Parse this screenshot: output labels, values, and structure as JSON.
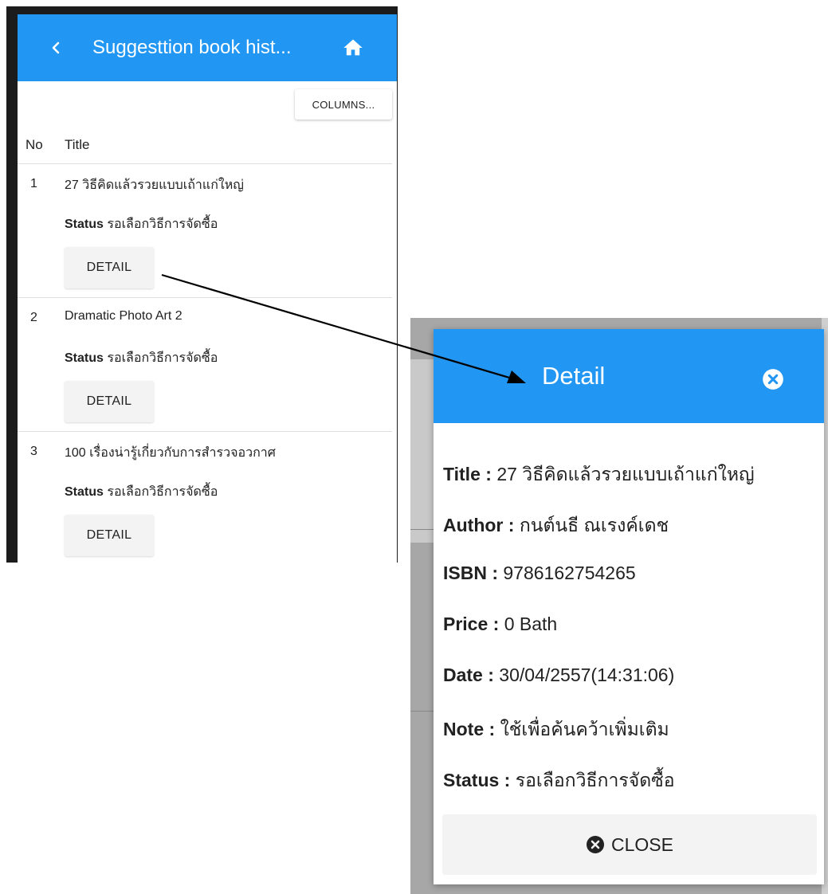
{
  "app_bar": {
    "title": "Suggesttion book hist...",
    "back_icon": "chevron-left-icon",
    "home_icon": "home-icon",
    "color": "#2196f3"
  },
  "toolbar": {
    "columns_label": "COLUMNS..."
  },
  "table": {
    "headers": {
      "no": "No",
      "title": "Title"
    },
    "status_label": "Status",
    "detail_label": "DETAIL",
    "rows": [
      {
        "no": "1",
        "title": "27 วิธีคิดแล้วรวยแบบเถ้าแก่ใหญ่",
        "status": "รอเลือกวิธีการจัดซื้อ"
      },
      {
        "no": "2",
        "title": "Dramatic Photo Art 2",
        "status": "รอเลือกวิธีการจัดซื้อ"
      },
      {
        "no": "3",
        "title": "100 เรื่องน่ารู้เกี่ยวกับการสำรวจอวกาศ",
        "status": "รอเลือกวิธีการจัดซื้อ"
      }
    ]
  },
  "dialog": {
    "title": "Detail",
    "close_icon": "close-circle-icon",
    "fields": [
      {
        "label": "Title :",
        "value": "27 วิธีคิดแล้วรวยแบบเถ้าแก่ใหญ่"
      },
      {
        "label": "Author :",
        "value": "กนต์นธี ณเรงค์เดช"
      },
      {
        "label": "ISBN :",
        "value": "9786162754265"
      },
      {
        "label": "Price :",
        "value": "0 Bath"
      },
      {
        "label": "Date :",
        "value": "30/04/2557(14:31:06)"
      },
      {
        "label": "Note :",
        "value": "ใช้เพื่อค้นคว้าเพิ่มเติม"
      },
      {
        "label": "Status :",
        "value": "รอเลือกวิธีการจัดซื้อ"
      }
    ],
    "close_label": "CLOSE"
  }
}
